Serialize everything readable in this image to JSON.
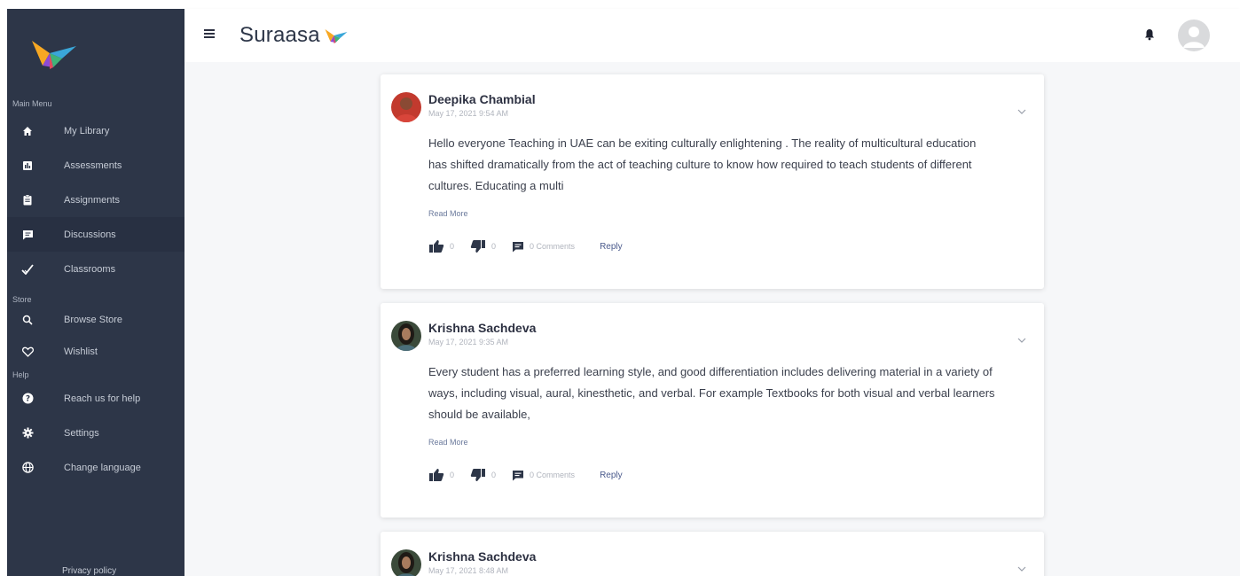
{
  "brand": {
    "name": "Suraasa"
  },
  "sidebar": {
    "main_menu_label": "Main Menu",
    "main_items": [
      {
        "label": "My Library",
        "icon": "home-icon"
      },
      {
        "label": "Assessments",
        "icon": "assessment-icon"
      },
      {
        "label": "Assignments",
        "icon": "clipboard-icon"
      },
      {
        "label": "Discussions",
        "icon": "discussion-icon"
      },
      {
        "label": "Classrooms",
        "icon": "check-icon"
      }
    ],
    "store_label": "Store",
    "store_items": [
      {
        "label": "Browse Store",
        "icon": "search-icon"
      },
      {
        "label": "Wishlist",
        "icon": "heart-icon"
      }
    ],
    "help_label": "Help",
    "help_items": [
      {
        "label": "Reach us for help",
        "icon": "help-icon"
      },
      {
        "label": "Settings",
        "icon": "gear-icon"
      },
      {
        "label": "Change language",
        "icon": "globe-icon"
      }
    ],
    "privacy": "Privacy policy"
  },
  "posts": [
    {
      "author": "Deepika Chambial",
      "date": "May 17, 2021 9:54 AM",
      "body": "Hello everyone Teaching in UAE can be exiting culturally enlightening . The reality of multicultural education has shifted dramatically from the act of teaching culture to know how required to teach students of different cultures. Educating a multi",
      "read_more": "Read More",
      "likes": "0",
      "dislikes": "0",
      "comments": "0 Comments",
      "reply": "Reply"
    },
    {
      "author": "Krishna Sachdeva",
      "date": "May 17, 2021 9:35 AM",
      "body": "Every student has a preferred learning style, and good differentiation includes delivering material in a variety of ways, including visual, aural, kinesthetic, and verbal. For example Textbooks for both visual and verbal learners should be available,",
      "read_more": "Read More",
      "likes": "0",
      "dislikes": "0",
      "comments": "0 Comments",
      "reply": "Reply"
    },
    {
      "author": "Krishna Sachdeva",
      "date": "May 17, 2021 8:48 AM"
    }
  ]
}
